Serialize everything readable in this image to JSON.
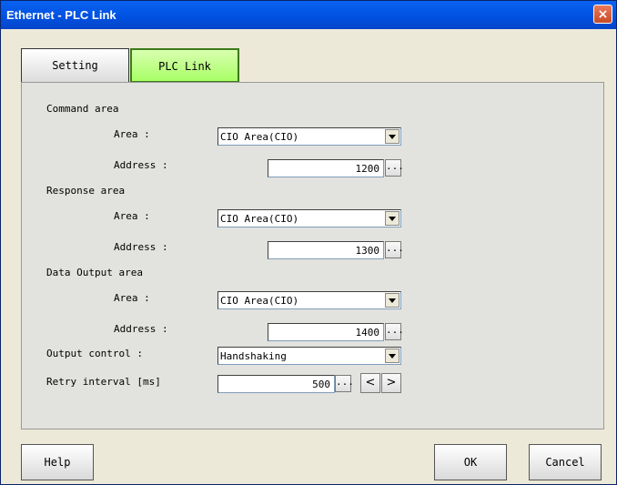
{
  "window": {
    "title": "Ethernet - PLC Link",
    "close_glyph": "×"
  },
  "tabs": [
    {
      "label": "Setting",
      "active": false
    },
    {
      "label": "PLC Link",
      "active": true
    }
  ],
  "command_area": {
    "heading": "Command area",
    "area_label": "Area :",
    "area_value": "CIO Area(CIO)",
    "address_label": "Address :",
    "address_value": "1200"
  },
  "response_area": {
    "heading": "Response area",
    "area_label": "Area :",
    "area_value": "CIO Area(CIO)",
    "address_label": "Address :",
    "address_value": "1300"
  },
  "data_output_area": {
    "heading": "Data Output area",
    "area_label": "Area :",
    "area_value": "CIO Area(CIO)",
    "address_label": "Address :",
    "address_value": "1400"
  },
  "output_control": {
    "label": "Output control :",
    "value": "Handshaking"
  },
  "retry_interval": {
    "label": "Retry interval [ms]",
    "value": "500",
    "decrement": "<",
    "increment": ">"
  },
  "ellipsis": "...",
  "footer": {
    "help": "Help",
    "ok": "OK",
    "cancel": "Cancel"
  },
  "colors": {
    "titlebar": "#0050e0",
    "active_tab": "#a8ff66",
    "dialog_bg": "#ece9d8",
    "panel_bg": "#e2e2de"
  }
}
